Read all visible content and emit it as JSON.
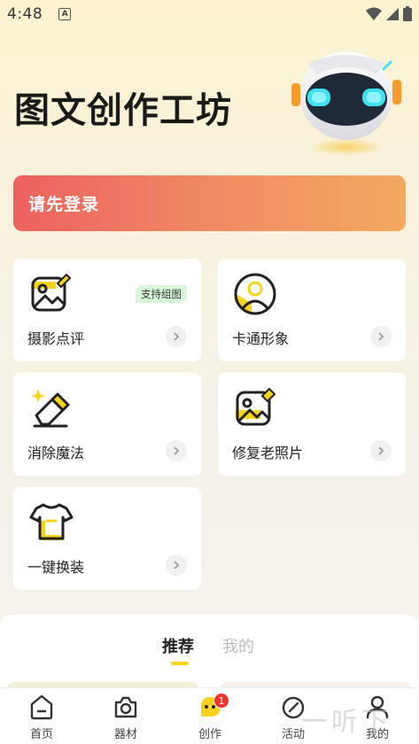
{
  "status_bar": {
    "time": "4:48",
    "notification_icon": "A"
  },
  "hero": {
    "title": "图文创作工坊"
  },
  "login_banner": {
    "label": "请先登录"
  },
  "cards": [
    {
      "label": "摄影点评",
      "icon": "photo-edit-icon",
      "tag": "支持组图"
    },
    {
      "label": "卡通形象",
      "icon": "avatar-icon"
    },
    {
      "label": "消除魔法",
      "icon": "eraser-icon"
    },
    {
      "label": "修复老照片",
      "icon": "photo-repair-icon"
    },
    {
      "label": "一键换装",
      "icon": "tshirt-icon"
    }
  ],
  "tabs": {
    "recommend": "推荐",
    "mine": "我的"
  },
  "bottom_nav": [
    {
      "label": "首页",
      "icon": "home-icon"
    },
    {
      "label": "器材",
      "icon": "camera-icon"
    },
    {
      "label": "创作",
      "icon": "chat-bubble-icon",
      "badge": "1"
    },
    {
      "label": "活动",
      "icon": "activity-icon"
    },
    {
      "label": "我的",
      "icon": "profile-icon"
    }
  ],
  "watermark": "一听下载",
  "colors": {
    "accent_yellow": "#f7d21e",
    "banner_start": "#ec6160",
    "banner_end": "#f3a960",
    "badge_red": "#f0312d"
  }
}
